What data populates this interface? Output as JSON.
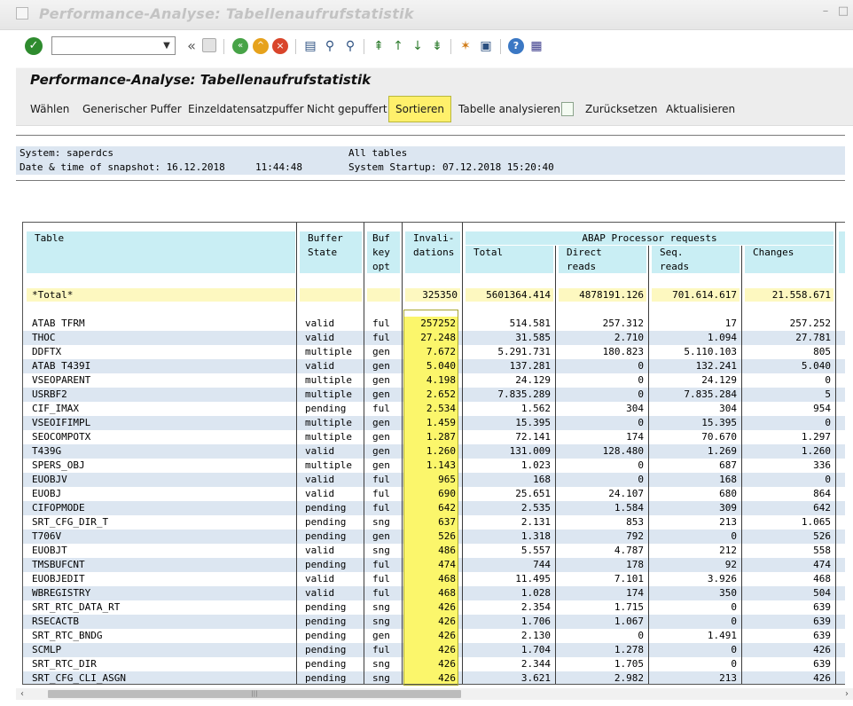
{
  "window": {
    "title": "Performance-Analyse: Tabellenaufrufstatistik",
    "minimize": "–",
    "restore": "□"
  },
  "toolbar": {
    "command_field_value": "",
    "icons": [
      "enter-icon",
      "back-icon",
      "exit-icon",
      "cancel-icon",
      "save-icon",
      "print-icon",
      "find-icon",
      "find-next-icon",
      "first-page-icon",
      "previous-page-icon",
      "next-page-icon",
      "last-page-icon",
      "new-session-icon",
      "shortcut-icon",
      "help-icon",
      "customize-layout-icon"
    ]
  },
  "page": {
    "title": "Performance-Analyse: Tabellenaufrufstatistik"
  },
  "app_toolbar": {
    "buttons": [
      "Wählen",
      "Generischer Puffer",
      "Einzeldatensatzpuffer",
      "Nicht gepuffert",
      "Sortieren",
      "Tabelle analysieren",
      "Zurücksetzen",
      "Aktualisieren"
    ],
    "active": "Sortieren"
  },
  "info": {
    "system_label": "System: saperdcs",
    "scope": "All tables",
    "snapshot_label": "Date & time of snapshot: 16.12.2018",
    "snapshot_time": "11:44:48",
    "startup": "System Startup: 07.12.2018 15:20:40"
  },
  "table": {
    "headers": {
      "table": "Table",
      "buffer_state": [
        "Buffer",
        "State"
      ],
      "buf_key_opt": [
        "Buf",
        "key",
        "opt"
      ],
      "invalidations": [
        "Invali-",
        "dations"
      ],
      "group": "ABAP Processor requests",
      "total": "Total",
      "direct_reads": [
        "Direct",
        "reads"
      ],
      "seq_reads": [
        "Seq.",
        "reads"
      ],
      "changes": "Changes"
    },
    "total_row": {
      "label": "*Total*",
      "invalidations": "325350",
      "total": "5601364.414",
      "direct_reads": "4878191.126",
      "seq_reads": "701.614.617",
      "changes": "21.558.671"
    },
    "rows": [
      [
        "ATAB TFRM",
        "valid",
        "ful",
        "257252",
        "514.581",
        "257.312",
        "17",
        "257.252"
      ],
      [
        "THOC",
        "valid",
        "ful",
        "27.248",
        "31.585",
        "2.710",
        "1.094",
        "27.781"
      ],
      [
        "DDFTX",
        "multiple",
        "gen",
        "7.672",
        "5.291.731",
        "180.823",
        "5.110.103",
        "805"
      ],
      [
        "ATAB T439I",
        "valid",
        "gen",
        "5.040",
        "137.281",
        "0",
        "132.241",
        "5.040"
      ],
      [
        "VSEOPARENT",
        "multiple",
        "gen",
        "4.198",
        "24.129",
        "0",
        "24.129",
        "0"
      ],
      [
        "USRBF2",
        "multiple",
        "gen",
        "2.652",
        "7.835.289",
        "0",
        "7.835.284",
        "5"
      ],
      [
        "CIF_IMAX",
        "pending",
        "ful",
        "2.534",
        "1.562",
        "304",
        "304",
        "954"
      ],
      [
        "VSEOIFIMPL",
        "multiple",
        "gen",
        "1.459",
        "15.395",
        "0",
        "15.395",
        "0"
      ],
      [
        "SEOCOMPOTX",
        "multiple",
        "gen",
        "1.287",
        "72.141",
        "174",
        "70.670",
        "1.297"
      ],
      [
        "T439G",
        "valid",
        "gen",
        "1.260",
        "131.009",
        "128.480",
        "1.269",
        "1.260"
      ],
      [
        "SPERS_OBJ",
        "multiple",
        "gen",
        "1.143",
        "1.023",
        "0",
        "687",
        "336"
      ],
      [
        "EUOBJV",
        "valid",
        "ful",
        "965",
        "168",
        "0",
        "168",
        "0"
      ],
      [
        "EUOBJ",
        "valid",
        "ful",
        "690",
        "25.651",
        "24.107",
        "680",
        "864"
      ],
      [
        "CIFOPMODE",
        "pending",
        "ful",
        "642",
        "2.535",
        "1.584",
        "309",
        "642"
      ],
      [
        "SRT_CFG_DIR_T",
        "pending",
        "sng",
        "637",
        "2.131",
        "853",
        "213",
        "1.065"
      ],
      [
        "T706V",
        "pending",
        "gen",
        "526",
        "1.318",
        "792",
        "0",
        "526"
      ],
      [
        "EUOBJT",
        "valid",
        "sng",
        "486",
        "5.557",
        "4.787",
        "212",
        "558"
      ],
      [
        "TMSBUFCNT",
        "pending",
        "ful",
        "474",
        "744",
        "178",
        "92",
        "474"
      ],
      [
        "EUOBJEDIT",
        "valid",
        "ful",
        "468",
        "11.495",
        "7.101",
        "3.926",
        "468"
      ],
      [
        "WBREGISTRY",
        "valid",
        "ful",
        "468",
        "1.028",
        "174",
        "350",
        "504"
      ],
      [
        "SRT_RTC_DATA_RT",
        "pending",
        "sng",
        "426",
        "2.354",
        "1.715",
        "0",
        "639"
      ],
      [
        "RSECACTB",
        "pending",
        "sng",
        "426",
        "1.706",
        "1.067",
        "0",
        "639"
      ],
      [
        "SRT_RTC_BNDG",
        "pending",
        "gen",
        "426",
        "2.130",
        "0",
        "1.491",
        "639"
      ],
      [
        "SCMLP",
        "pending",
        "ful",
        "426",
        "1.704",
        "1.278",
        "0",
        "426"
      ],
      [
        "SRT_RTC_DIR",
        "pending",
        "sng",
        "426",
        "2.344",
        "1.705",
        "0",
        "639"
      ],
      [
        "SRT_CFG_CLI_ASGN",
        "pending",
        "sng",
        "426",
        "3.621",
        "2.982",
        "213",
        "426"
      ]
    ]
  },
  "scrollbar": {
    "left": "‹",
    "right": "›",
    "grip": "|||"
  },
  "colors": {
    "highlight": "#fbf66b",
    "header": "#c9eef4",
    "stripe": "#dce6f1",
    "total": "#fdf8c0"
  }
}
